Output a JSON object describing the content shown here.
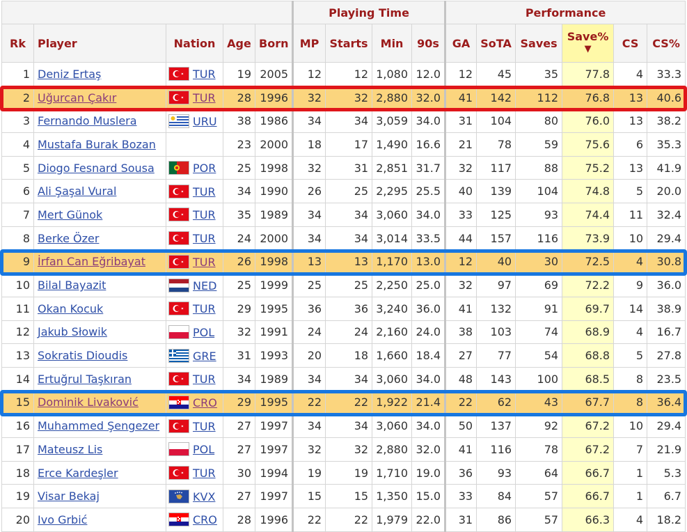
{
  "groups": {
    "playing_time": "Playing Time",
    "performance": "Performance"
  },
  "columns": [
    "Rk",
    "Player",
    "Nation",
    "Age",
    "Born",
    "MP",
    "Starts",
    "Min",
    "90s",
    "GA",
    "SoTA",
    "Saves",
    "Save%",
    "CS",
    "CS%"
  ],
  "sort_arrow": "▼",
  "rows": [
    {
      "rk": "1",
      "player": "Deniz Ertaş",
      "flag": "tur",
      "nation": "TUR",
      "age": "19",
      "born": "2005",
      "mp": "12",
      "starts": "12",
      "min": "1,080",
      "n90": "12.0",
      "ga": "12",
      "sota": "45",
      "saves": "35",
      "savepct": "77.8",
      "cs": "4",
      "cspct": "33.3"
    },
    {
      "rk": "2",
      "player": "Uğurcan Çakır",
      "flag": "tur",
      "nation": "TUR",
      "age": "28",
      "born": "1996",
      "mp": "32",
      "starts": "32",
      "min": "2,880",
      "n90": "32.0",
      "ga": "41",
      "sota": "142",
      "saves": "112",
      "savepct": "76.8",
      "cs": "13",
      "cspct": "40.6",
      "hl": "red"
    },
    {
      "rk": "3",
      "player": "Fernando Muslera",
      "flag": "uru",
      "nation": "URU",
      "age": "38",
      "born": "1986",
      "mp": "34",
      "starts": "34",
      "min": "3,059",
      "n90": "34.0",
      "ga": "31",
      "sota": "104",
      "saves": "80",
      "savepct": "76.0",
      "cs": "13",
      "cspct": "38.2"
    },
    {
      "rk": "4",
      "player": "Mustafa Burak Bozan",
      "flag": "",
      "nation": "",
      "age": "23",
      "born": "2000",
      "mp": "18",
      "starts": "17",
      "min": "1,490",
      "n90": "16.6",
      "ga": "21",
      "sota": "78",
      "saves": "59",
      "savepct": "75.6",
      "cs": "6",
      "cspct": "35.3"
    },
    {
      "rk": "5",
      "player": "Diogo Fesnard Sousa",
      "flag": "por",
      "nation": "POR",
      "age": "25",
      "born": "1998",
      "mp": "32",
      "starts": "31",
      "min": "2,851",
      "n90": "31.7",
      "ga": "32",
      "sota": "117",
      "saves": "88",
      "savepct": "75.2",
      "cs": "13",
      "cspct": "41.9"
    },
    {
      "rk": "6",
      "player": "Ali Şaşal Vural",
      "flag": "tur",
      "nation": "TUR",
      "age": "34",
      "born": "1990",
      "mp": "26",
      "starts": "25",
      "min": "2,295",
      "n90": "25.5",
      "ga": "40",
      "sota": "139",
      "saves": "104",
      "savepct": "74.8",
      "cs": "5",
      "cspct": "20.0"
    },
    {
      "rk": "7",
      "player": "Mert Günok",
      "flag": "tur",
      "nation": "TUR",
      "age": "35",
      "born": "1989",
      "mp": "34",
      "starts": "34",
      "min": "3,060",
      "n90": "34.0",
      "ga": "33",
      "sota": "125",
      "saves": "93",
      "savepct": "74.4",
      "cs": "11",
      "cspct": "32.4"
    },
    {
      "rk": "8",
      "player": "Berke Özer",
      "flag": "tur",
      "nation": "TUR",
      "age": "24",
      "born": "2000",
      "mp": "34",
      "starts": "34",
      "min": "3,014",
      "n90": "33.5",
      "ga": "44",
      "sota": "157",
      "saves": "116",
      "savepct": "73.9",
      "cs": "10",
      "cspct": "29.4"
    },
    {
      "rk": "9",
      "player": "İrfan Can Eğribayat",
      "flag": "tur",
      "nation": "TUR",
      "age": "26",
      "born": "1998",
      "mp": "13",
      "starts": "13",
      "min": "1,170",
      "n90": "13.0",
      "ga": "12",
      "sota": "40",
      "saves": "30",
      "savepct": "72.5",
      "cs": "4",
      "cspct": "30.8",
      "hl": "blue"
    },
    {
      "rk": "10",
      "player": "Bilal Bayazit",
      "flag": "ned",
      "nation": "NED",
      "age": "25",
      "born": "1999",
      "mp": "25",
      "starts": "25",
      "min": "2,250",
      "n90": "25.0",
      "ga": "32",
      "sota": "97",
      "saves": "69",
      "savepct": "72.2",
      "cs": "9",
      "cspct": "36.0"
    },
    {
      "rk": "11",
      "player": "Okan Kocuk",
      "flag": "tur",
      "nation": "TUR",
      "age": "29",
      "born": "1995",
      "mp": "36",
      "starts": "36",
      "min": "3,240",
      "n90": "36.0",
      "ga": "41",
      "sota": "132",
      "saves": "91",
      "savepct": "69.7",
      "cs": "14",
      "cspct": "38.9"
    },
    {
      "rk": "12",
      "player": "Jakub Słowik",
      "flag": "pol",
      "nation": "POL",
      "age": "32",
      "born": "1991",
      "mp": "24",
      "starts": "24",
      "min": "2,160",
      "n90": "24.0",
      "ga": "38",
      "sota": "103",
      "saves": "74",
      "savepct": "68.9",
      "cs": "4",
      "cspct": "16.7"
    },
    {
      "rk": "13",
      "player": "Sokratis Dioudis",
      "flag": "gre",
      "nation": "GRE",
      "age": "31",
      "born": "1993",
      "mp": "20",
      "starts": "18",
      "min": "1,660",
      "n90": "18.4",
      "ga": "27",
      "sota": "77",
      "saves": "54",
      "savepct": "68.8",
      "cs": "5",
      "cspct": "27.8"
    },
    {
      "rk": "14",
      "player": "Ertuğrul Taşkıran",
      "flag": "tur",
      "nation": "TUR",
      "age": "34",
      "born": "1989",
      "mp": "34",
      "starts": "34",
      "min": "3,060",
      "n90": "34.0",
      "ga": "48",
      "sota": "143",
      "saves": "100",
      "savepct": "68.5",
      "cs": "8",
      "cspct": "23.5"
    },
    {
      "rk": "15",
      "player": "Dominik Livaković",
      "flag": "cro",
      "nation": "CRO",
      "age": "29",
      "born": "1995",
      "mp": "22",
      "starts": "22",
      "min": "1,922",
      "n90": "21.4",
      "ga": "22",
      "sota": "62",
      "saves": "43",
      "savepct": "67.7",
      "cs": "8",
      "cspct": "36.4",
      "hl": "blue"
    },
    {
      "rk": "16",
      "player": "Muhammed Şengezer",
      "flag": "tur",
      "nation": "TUR",
      "age": "27",
      "born": "1997",
      "mp": "34",
      "starts": "34",
      "min": "3,060",
      "n90": "34.0",
      "ga": "50",
      "sota": "137",
      "saves": "92",
      "savepct": "67.2",
      "cs": "10",
      "cspct": "29.4"
    },
    {
      "rk": "17",
      "player": "Mateusz Lis",
      "flag": "pol",
      "nation": "POL",
      "age": "27",
      "born": "1997",
      "mp": "32",
      "starts": "32",
      "min": "2,880",
      "n90": "32.0",
      "ga": "41",
      "sota": "116",
      "saves": "78",
      "savepct": "67.2",
      "cs": "7",
      "cspct": "21.9"
    },
    {
      "rk": "18",
      "player": "Erce Kardeşler",
      "flag": "tur",
      "nation": "TUR",
      "age": "30",
      "born": "1994",
      "mp": "19",
      "starts": "19",
      "min": "1,710",
      "n90": "19.0",
      "ga": "36",
      "sota": "93",
      "saves": "64",
      "savepct": "66.7",
      "cs": "1",
      "cspct": "5.3"
    },
    {
      "rk": "19",
      "player": "Visar Bekaj",
      "flag": "kvx",
      "nation": "KVX",
      "age": "27",
      "born": "1997",
      "mp": "15",
      "starts": "15",
      "min": "1,350",
      "n90": "15.0",
      "ga": "33",
      "sota": "84",
      "saves": "57",
      "savepct": "66.7",
      "cs": "1",
      "cspct": "6.7"
    },
    {
      "rk": "20",
      "player": "Ivo Grbić",
      "flag": "cro",
      "nation": "CRO",
      "age": "28",
      "born": "1996",
      "mp": "22",
      "starts": "22",
      "min": "1,979",
      "n90": "22.0",
      "ga": "31",
      "sota": "86",
      "saves": "57",
      "savepct": "66.3",
      "cs": "4",
      "cspct": "18.2"
    }
  ]
}
